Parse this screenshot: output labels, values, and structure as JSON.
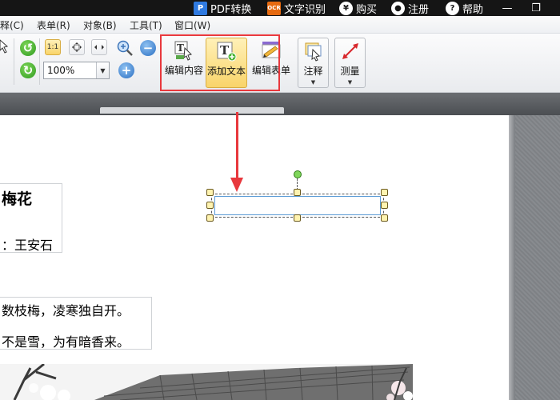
{
  "titlebar": {
    "pdf_convert": {
      "icon": "pdf-icon",
      "icon_glyph": "P",
      "label": "PDF转换"
    },
    "ocr": {
      "icon": "ocr-icon",
      "icon_glyph": "OCR",
      "label": "文字识别"
    },
    "buy": {
      "icon": "yen-icon",
      "icon_glyph": "¥",
      "label": "购买"
    },
    "register": {
      "icon": "user-icon",
      "icon_glyph": "●",
      "label": "注册"
    },
    "help": {
      "icon": "help-icon",
      "icon_glyph": "?",
      "label": "帮助"
    },
    "minimize": "—",
    "maximize": "❐"
  },
  "menubar": {
    "items": [
      "释(C)",
      "表单(R)",
      "对象(B)",
      "工具(T)",
      "窗口(W)"
    ]
  },
  "toolbar": {
    "zoom_value": "100%",
    "actual_size_label": "1:1",
    "edit_content": "编辑内容",
    "add_text": "添加文本",
    "edit_form": "编辑表单",
    "annotate": "注释",
    "measure": "测量",
    "dropdown_glyph": "▼",
    "add_text_glyph": "T",
    "edit_content_glyph": "T"
  },
  "document": {
    "poem_title": "梅花",
    "poem_author": "：王安石",
    "poem_lines": [
      "数枝梅，凌寒独自开。",
      "不是雪，为有暗香来。"
    ],
    "new_textbox_value": ""
  },
  "colors": {
    "annotation_red": "#e8383d",
    "active_button": "#f9d46a",
    "titlebar": "#151515"
  }
}
